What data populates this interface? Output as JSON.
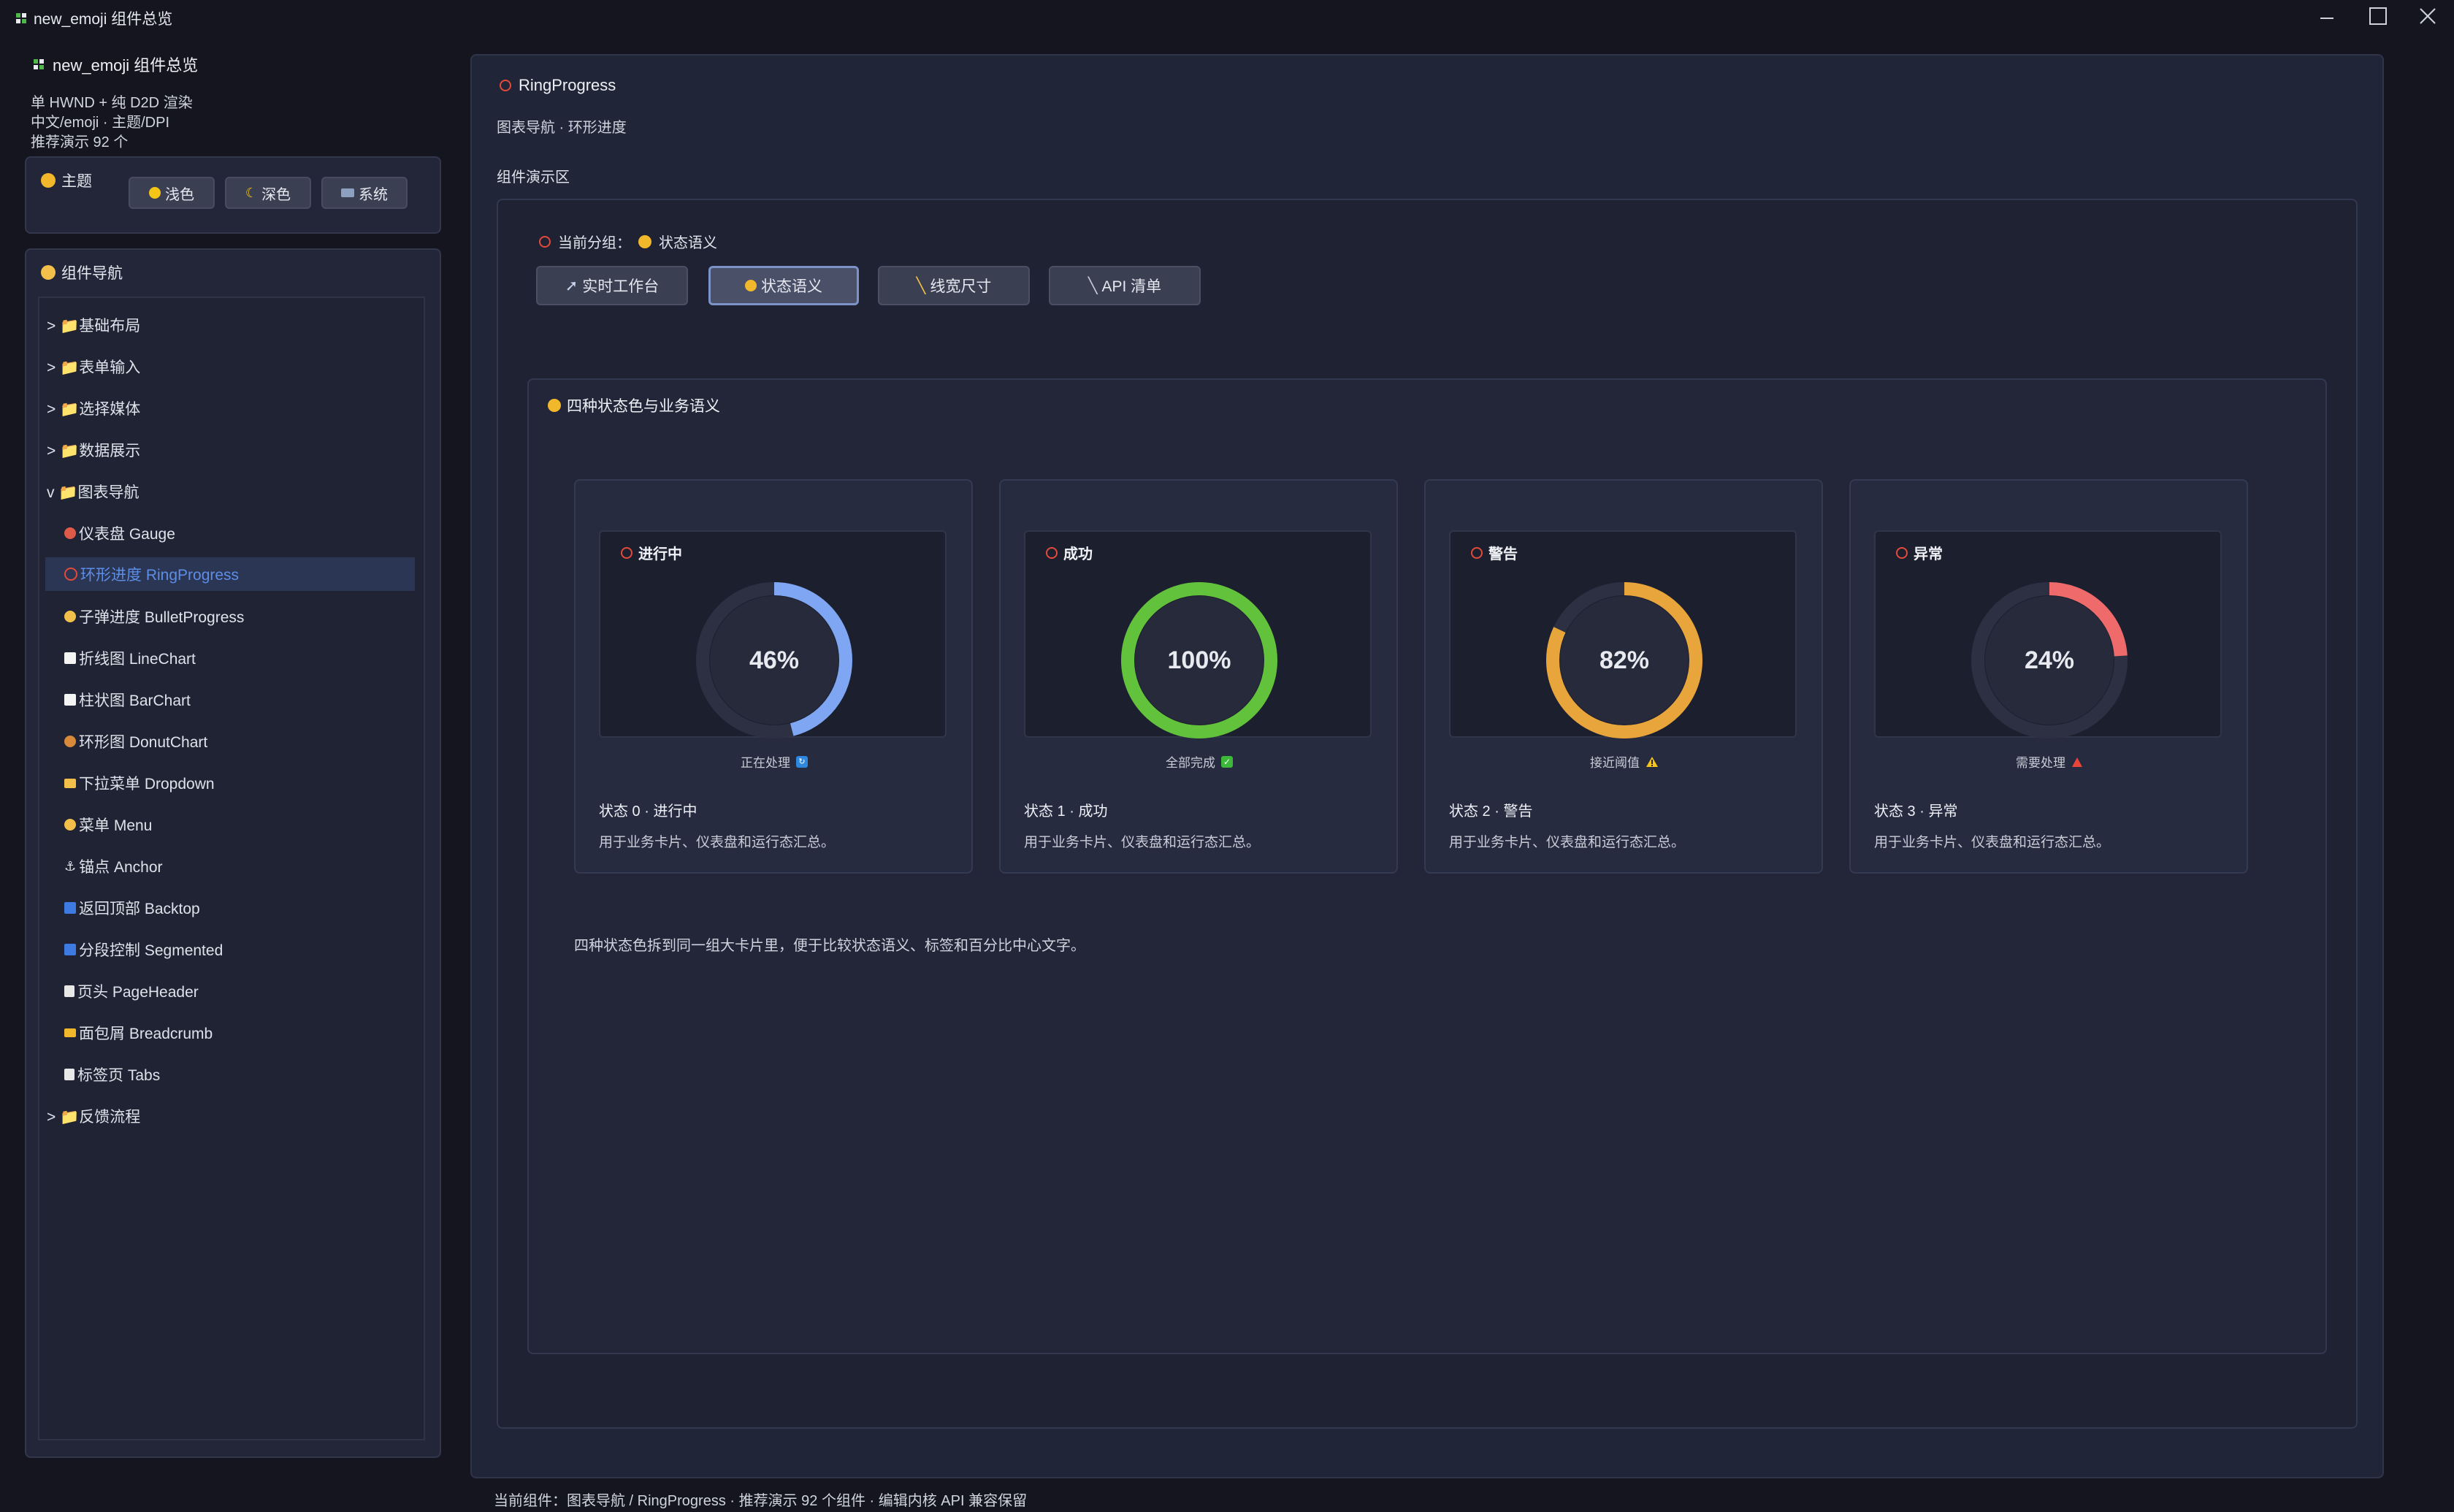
{
  "window": {
    "title": "new_emoji 组件总览",
    "controls": [
      "minimize",
      "maximize",
      "close"
    ]
  },
  "sidebar": {
    "header": "new_emoji 组件总览",
    "info_lines": [
      "单 HWND + 纯 D2D 渲染",
      "中文/emoji · 主题/DPI",
      "推荐演示 92 个"
    ],
    "theme": {
      "label": "主题",
      "options": [
        "浅色",
        "深色",
        "系统"
      ]
    },
    "nav": {
      "title": "组件导航",
      "items": [
        {
          "label": "> 📁基础布局"
        },
        {
          "label": "> 📁表单输入"
        },
        {
          "label": "> 📁选择媒体"
        },
        {
          "label": "> 📁数据展示"
        },
        {
          "label": "v 📁图表导航"
        },
        {
          "label": "仪表盘 Gauge"
        },
        {
          "label": "环形进度 RingProgress"
        },
        {
          "label": "子弹进度 BulletProgress"
        },
        {
          "label": "折线图 LineChart"
        },
        {
          "label": "柱状图 BarChart"
        },
        {
          "label": "环形图 DonutChart"
        },
        {
          "label": "下拉菜单 Dropdown"
        },
        {
          "label": "菜单 Menu"
        },
        {
          "label": "锚点 Anchor"
        },
        {
          "label": "返回顶部 Backtop"
        },
        {
          "label": "分段控制 Segmented"
        },
        {
          "label": "页头 PageHeader"
        },
        {
          "label": "面包屑 Breadcrumb"
        },
        {
          "label": "标签页 Tabs"
        },
        {
          "label": "> 📁反馈流程"
        }
      ]
    }
  },
  "main": {
    "title": "RingProgress",
    "subtitle": "图表导航 · 环形进度",
    "demo_label": "组件演示区",
    "group_label": "当前分组：",
    "group_value": "状态语义",
    "tabs": [
      "实时工作台",
      "状态语义",
      "线宽尺寸",
      "API 清单"
    ],
    "active_tab": "状态语义",
    "panel_title": "四种状态色与业务语义",
    "cards": [
      {
        "head": "进行中",
        "value": "46%",
        "progress": 0.46,
        "color": "#7ea6f2",
        "caption": "正在处理",
        "caption_icon": "🔄",
        "title": "状态 0 · 进行中",
        "desc": "用于业务卡片、仪表盘和运行态汇总。"
      },
      {
        "head": "成功",
        "value": "100%",
        "progress": 1.0,
        "color": "#63c23c",
        "caption": "全部完成",
        "caption_icon": "✅",
        "title": "状态 1 · 成功",
        "desc": "用于业务卡片、仪表盘和运行态汇总。"
      },
      {
        "head": "警告",
        "value": "82%",
        "progress": 0.82,
        "color": "#e8a53c",
        "caption": "接近阈值",
        "caption_icon": "⚠",
        "title": "状态 2 · 警告",
        "desc": "用于业务卡片、仪表盘和运行态汇总。"
      },
      {
        "head": "异常",
        "value": "24%",
        "progress": 0.24,
        "color": "#ef6a6a",
        "caption": "需要处理",
        "caption_icon": "🔺",
        "title": "状态 3 · 异常",
        "desc": "用于业务卡片、仪表盘和运行态汇总。"
      }
    ],
    "note": "四种状态色拆到同一组大卡片里，便于比较状态语义、标签和百分比中心文字。"
  },
  "footer": "当前组件：图表导航 / RingProgress · 推荐演示 92 个组件 · 编辑内核 API 兼容保留"
}
